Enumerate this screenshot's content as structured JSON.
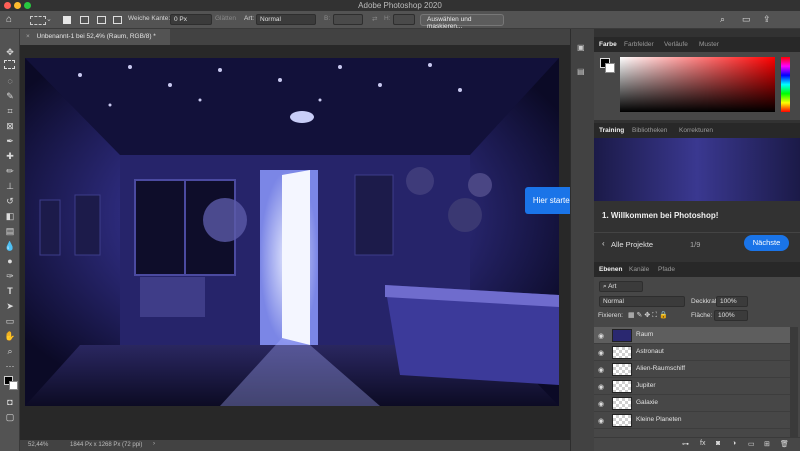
{
  "titlebar": {
    "app_title": "Adobe Photoshop 2020"
  },
  "options": {
    "feather_label": "Weiche Kante:",
    "feather_value": "0 Px",
    "antialias_label": "Glätten",
    "style_label": "Art:",
    "style_value": "Normal",
    "width_label": "B:",
    "height_label": "H:",
    "select_mask_button": "Auswählen und maskieren..."
  },
  "document": {
    "tab_title": "Unbenannt-1 bei 52,4% (Raum, RGB/8) *",
    "zoom": "52,44%",
    "dimensions": "1844 Px x 1268 Px (72 ppi)"
  },
  "tooltip": {
    "label": "Hier starten"
  },
  "color_panel": {
    "tabs": [
      "Farbe",
      "Farbfelder",
      "Verläufe",
      "Muster"
    ],
    "active_tab": 0
  },
  "training_panel": {
    "tabs": [
      "Training",
      "Bibliotheken",
      "Korrekturen"
    ],
    "step_title": "1. Willkommen bei Photoshop!",
    "back_label": "Alle Projekte",
    "progress": "1/9",
    "next_button": "Nächste"
  },
  "layers_panel": {
    "tabs": [
      "Ebenen",
      "Kanäle",
      "Pfade"
    ],
    "filter_type": "Art",
    "blend_mode": "Normal",
    "opacity_label": "Deckkraft:",
    "opacity_value": "100%",
    "lock_label": "Fixieren:",
    "fill_label": "Fläche:",
    "fill_value": "100%",
    "layers": [
      "Raum",
      "Astronaut",
      "Alien-Raumschiff",
      "Jupiter",
      "Galaxie",
      "Kleine Planeten"
    ],
    "selected_layer": 0
  },
  "colors": {
    "accent": "#1a74e8",
    "panel_bg": "#323232",
    "toolbar_bg": "#535353"
  }
}
